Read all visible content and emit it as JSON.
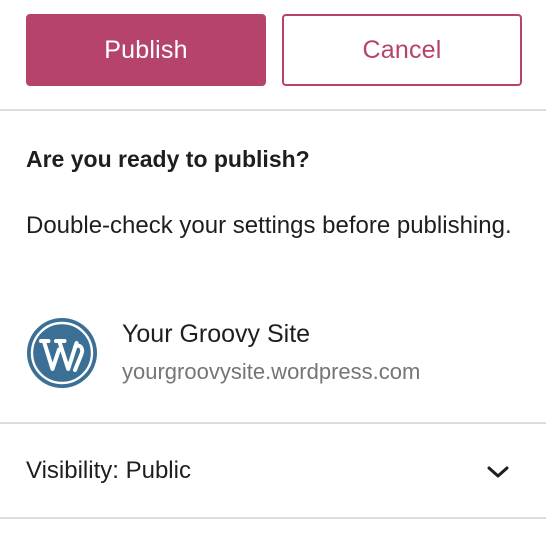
{
  "actions": {
    "publish_label": "Publish",
    "cancel_label": "Cancel"
  },
  "prepublish": {
    "heading": "Are you ready to publish?",
    "description": "Double-check your settings before publishing.",
    "site_name": "Your Groovy Site",
    "site_url": "yourgroovysite.wordpress.com",
    "site_icon": "wordpress-logo-icon"
  },
  "visibility": {
    "label": "Visibility:",
    "value": "Public",
    "icon": "chevron-down-icon"
  },
  "colors": {
    "accent": "#b6436b",
    "text": "#1e1e1e",
    "muted": "#757575",
    "divider": "#dcdcde",
    "logo": "#3b6f96"
  }
}
